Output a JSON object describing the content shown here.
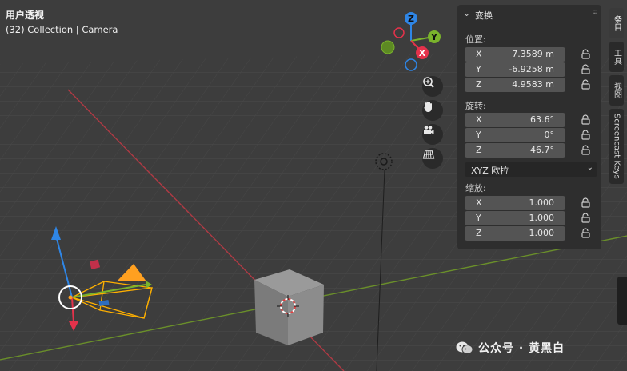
{
  "viewport": {
    "title": "用户透视",
    "subtitle": "(32) Collection | Camera",
    "gizmo": {
      "z": "Z",
      "y": "Y",
      "x": "X"
    },
    "nav_icons": [
      "zoom-icon",
      "hand-pan-icon",
      "camera-view-icon",
      "grid-ortho-icon"
    ]
  },
  "npanel": {
    "section_title": "变换",
    "location": {
      "label": "位置:",
      "fields": [
        {
          "axis": "X",
          "value": "7.3589 m"
        },
        {
          "axis": "Y",
          "value": "-6.9258 m"
        },
        {
          "axis": "Z",
          "value": "4.9583 m"
        }
      ]
    },
    "rotation": {
      "label": "旋转:",
      "fields": [
        {
          "axis": "X",
          "value": "63.6°"
        },
        {
          "axis": "Y",
          "value": "0°"
        },
        {
          "axis": "Z",
          "value": "46.7°"
        }
      ],
      "mode": "XYZ 欧拉"
    },
    "scale": {
      "label": "缩放:",
      "fields": [
        {
          "axis": "X",
          "value": "1.000"
        },
        {
          "axis": "Y",
          "value": "1.000"
        },
        {
          "axis": "Z",
          "value": "1.000"
        }
      ]
    }
  },
  "tabs": [
    "条目",
    "工具",
    "视图",
    "Screencast Keys"
  ],
  "watermark": "公众号 · 黄黑白",
  "colors": {
    "x_axis": "#e5324b",
    "y_axis": "#7ab32c",
    "z_axis": "#2f86e6",
    "camera": "#ffb000",
    "background": "#3d3d3d"
  }
}
